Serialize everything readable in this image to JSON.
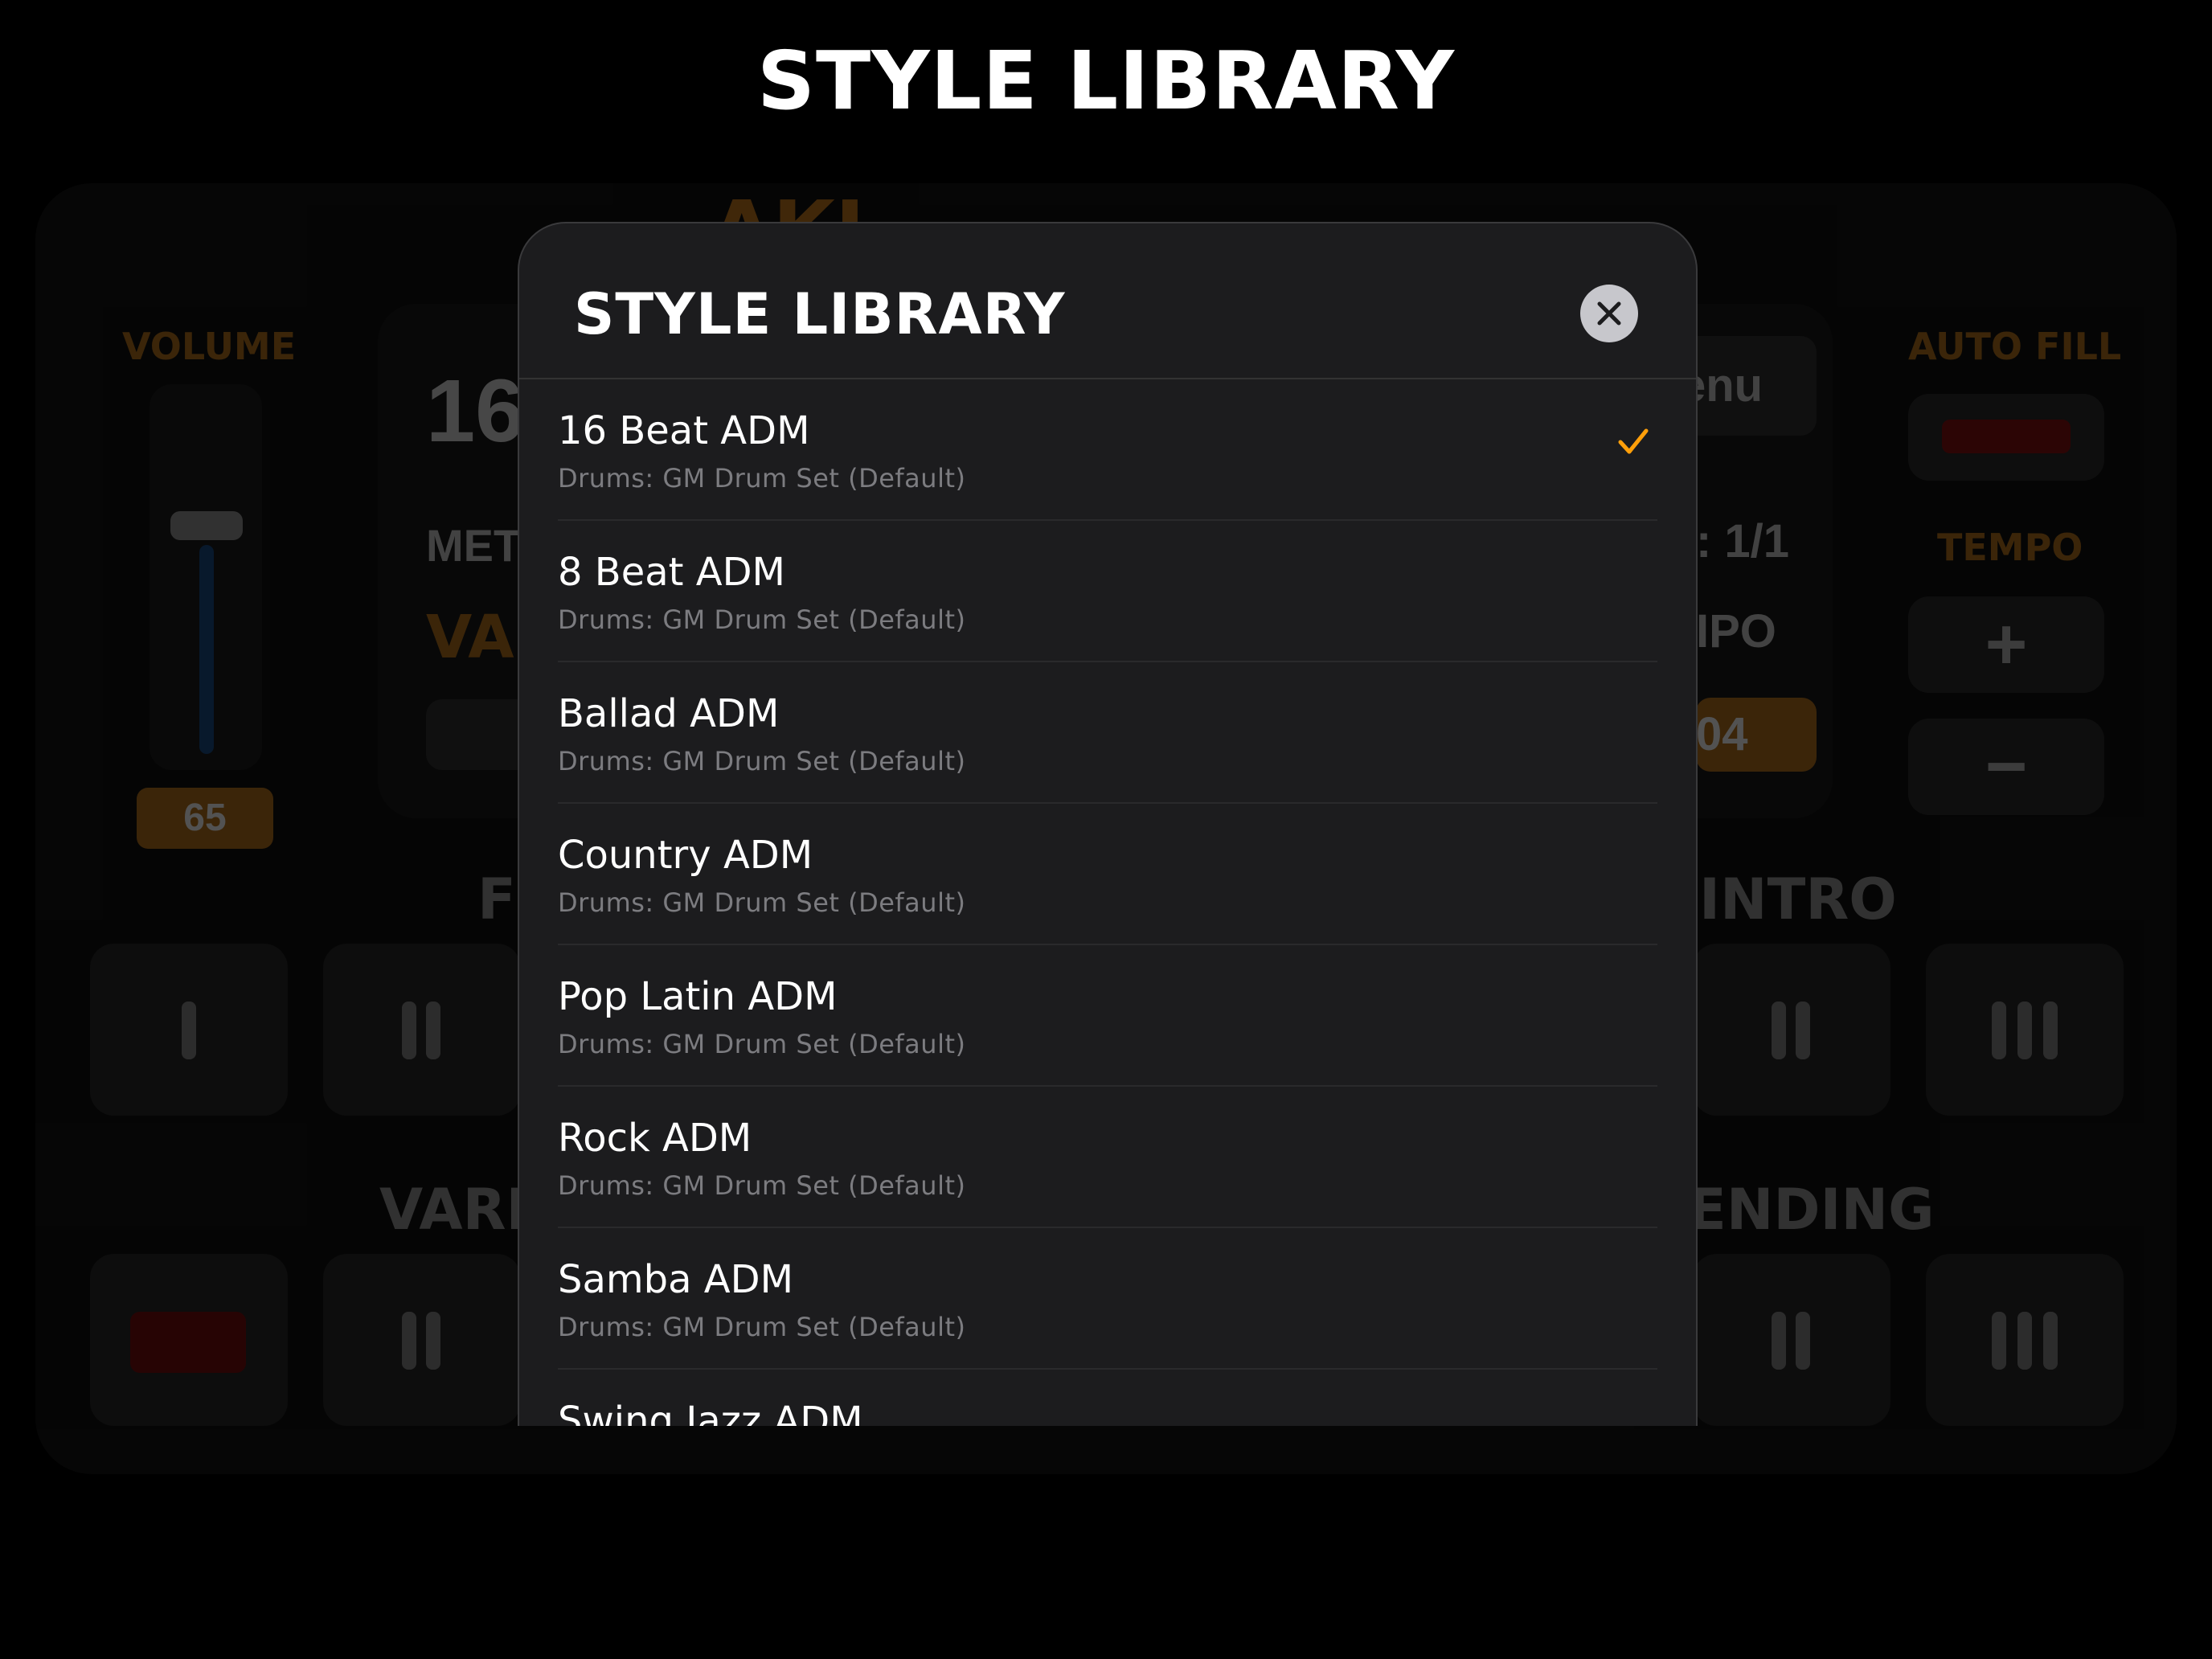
{
  "page_heading": "STYLE LIBRARY",
  "background": {
    "app_title_fragment": "AKI",
    "volume_label": "VOLUME",
    "volume_value": "65",
    "volume_level": 0.65,
    "auto_fill_label": "AUTO FILL",
    "tempo_label": "TEMPO",
    "tempo_plus": "+",
    "tempo_minus": "−",
    "display_left_big": "16",
    "display_left_met": "MET",
    "display_left_var": "VAI",
    "display_right_menu": "enu",
    "display_right_measure": ": 1/1",
    "display_right_tempo": "IPO",
    "display_right_tempo_value": "04",
    "fill_label_fragment": "FI",
    "intro_label": "INTRO",
    "variation_label_fragment": "VARI",
    "ending_label": "ENDING",
    "pad_glyph_1": "I",
    "pad_glyph_2": "II",
    "pad_glyph_3": "III"
  },
  "modal": {
    "title": "STYLE LIBRARY",
    "close_icon": "close-icon",
    "selected_index": 0,
    "accent_color": "#ff9f0a",
    "styles": [
      {
        "name": "16 Beat ADM",
        "drums": "Drums: GM Drum Set (Default)"
      },
      {
        "name": "8 Beat ADM",
        "drums": "Drums: GM Drum Set (Default)"
      },
      {
        "name": "Ballad ADM",
        "drums": "Drums: GM Drum Set (Default)"
      },
      {
        "name": "Country ADM",
        "drums": "Drums: GM Drum Set (Default)"
      },
      {
        "name": "Pop Latin ADM",
        "drums": "Drums: GM Drum Set (Default)"
      },
      {
        "name": "Rock ADM",
        "drums": "Drums: GM Drum Set (Default)"
      },
      {
        "name": "Samba ADM",
        "drums": "Drums: GM Drum Set (Default)"
      },
      {
        "name": "Swing Jazz ADM",
        "drums": ""
      }
    ]
  }
}
